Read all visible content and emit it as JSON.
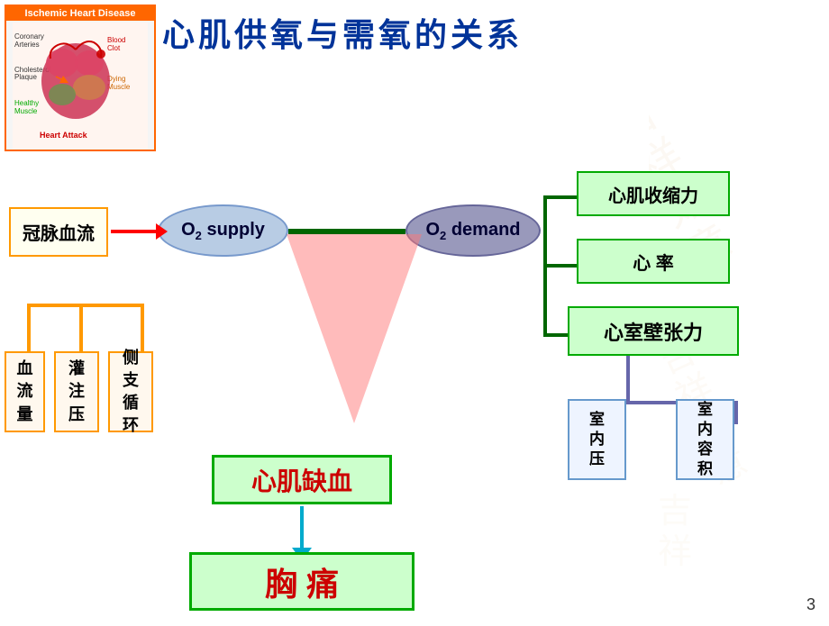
{
  "image_box": {
    "title": "Ischemic Heart Disease"
  },
  "main_title": "心肌供氧与需氧的关系",
  "diagram": {
    "guanmai_label": "冠脉血流",
    "supply_label": "O₂ supply",
    "demand_label": "O₂ demand",
    "quexue_label": "心肌缺血",
    "xiongtong_label": "胸  痛",
    "right_boxes": {
      "shousuoli": "心肌收缩力",
      "xinlv": "心  率",
      "zhangli": "心室壁张力"
    },
    "sub_boxes": {
      "neizhang": "室\n内\n压",
      "neirong": "室\n内\n容\n积"
    },
    "left_sub_boxes": {
      "xueliu": "血\n流\n量",
      "guanzhu": "灌\n注\n压",
      "cexun": "侧\n支\n循\n环"
    }
  },
  "page_number": "3"
}
